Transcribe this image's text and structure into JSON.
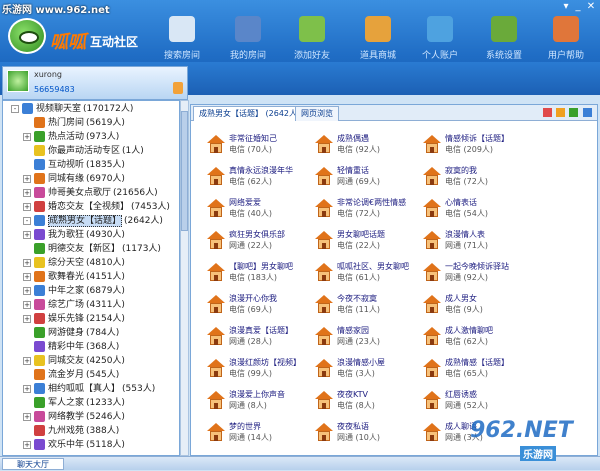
{
  "watermark_top": "乐游网 www.962.net",
  "logo": {
    "text": "呱呱",
    "subtitle": "互动社区"
  },
  "toolbar": [
    {
      "label": "搜索房间",
      "icon": "search-icon",
      "color": "#d9e7f5"
    },
    {
      "label": "我的房间",
      "icon": "computer-icon",
      "color": "#5a86c9"
    },
    {
      "label": "添加好友",
      "icon": "add-friend-icon",
      "color": "#7ec04a"
    },
    {
      "label": "道具商城",
      "icon": "shop-icon",
      "color": "#e6a23c"
    },
    {
      "label": "个人账户",
      "icon": "card-icon",
      "color": "#4ea2e0"
    },
    {
      "label": "系统设置",
      "icon": "settings-icon",
      "color": "#6aaa3a"
    },
    {
      "label": "用户帮助",
      "icon": "help-user-icon",
      "color": "#e0763a"
    }
  ],
  "user": {
    "name": "xurong",
    "id": "56659483"
  },
  "tree": [
    {
      "label": "视频聊天室",
      "count": "(170172人)",
      "level": 0,
      "expand": "-",
      "icon": "#3b7fd6"
    },
    {
      "label": "热门房间",
      "count": "(5619人)",
      "level": 1,
      "expand": "",
      "icon": "#e0731a"
    },
    {
      "label": "热点活动",
      "count": "(973人)",
      "level": 1,
      "expand": "+",
      "icon": "#3aa02a"
    },
    {
      "label": "你最声动活动专区",
      "count": "(1人)",
      "level": 1,
      "expand": "",
      "icon": "#e8c220"
    },
    {
      "label": "互动视听",
      "count": "(1835人)",
      "level": 1,
      "expand": "",
      "icon": "#3b7fd6"
    },
    {
      "label": "同城有缘",
      "count": "(6970人)",
      "level": 1,
      "expand": "+",
      "icon": "#e0731a"
    },
    {
      "label": "帅哥美女点歌厅",
      "count": "(21656人)",
      "level": 1,
      "expand": "+",
      "icon": "#c84a9a"
    },
    {
      "label": "婚恋交友【全视频】",
      "count": "(7453人)",
      "level": 1,
      "expand": "+",
      "icon": "#d04040"
    },
    {
      "label": "成熟男女【话题】",
      "count": "(2642人)",
      "level": 1,
      "expand": "-",
      "icon": "#3b7fd6",
      "selected": true
    },
    {
      "label": "我为歌狂",
      "count": "(4930人)",
      "level": 1,
      "expand": "+",
      "icon": "#7a4ad0"
    },
    {
      "label": "明德交友【新区】",
      "count": "(1173人)",
      "level": 1,
      "expand": "",
      "icon": "#3aa02a"
    },
    {
      "label": "综分天空",
      "count": "(4810人)",
      "level": 1,
      "expand": "+",
      "icon": "#e8c220"
    },
    {
      "label": "歌舞春光",
      "count": "(4151人)",
      "level": 1,
      "expand": "+",
      "icon": "#e0731a"
    },
    {
      "label": "中年之家",
      "count": "(6879人)",
      "level": 1,
      "expand": "+",
      "icon": "#3b7fd6"
    },
    {
      "label": "综艺广场",
      "count": "(4311人)",
      "level": 1,
      "expand": "+",
      "icon": "#c84a9a"
    },
    {
      "label": "娱乐先锋",
      "count": "(2154人)",
      "level": 1,
      "expand": "+",
      "icon": "#d04040"
    },
    {
      "label": "网游健身",
      "count": "(784人)",
      "level": 1,
      "expand": "",
      "icon": "#3aa02a"
    },
    {
      "label": "精彩中年",
      "count": "(368人)",
      "level": 1,
      "expand": "",
      "icon": "#7a4ad0"
    },
    {
      "label": "同城交友",
      "count": "(4250人)",
      "level": 1,
      "expand": "+",
      "icon": "#e8c220"
    },
    {
      "label": "流金岁月",
      "count": "(545人)",
      "level": 1,
      "expand": "",
      "icon": "#e0731a"
    },
    {
      "label": "相约呱呱【真人】",
      "count": "(553人)",
      "level": 1,
      "expand": "+",
      "icon": "#3b7fd6"
    },
    {
      "label": "军人之家",
      "count": "(1233人)",
      "level": 1,
      "expand": "",
      "icon": "#3aa02a"
    },
    {
      "label": "网络教学",
      "count": "(5246人)",
      "level": 1,
      "expand": "+",
      "icon": "#c84a9a"
    },
    {
      "label": "九州戏苑",
      "count": "(388人)",
      "level": 1,
      "expand": "",
      "icon": "#d04040"
    },
    {
      "label": "欢乐中年",
      "count": "(5118人)",
      "level": 1,
      "expand": "+",
      "icon": "#7a4ad0"
    }
  ],
  "tabs": [
    {
      "label": "成熟男女【话题】 (2642人)",
      "active": true
    },
    {
      "label": "网页浏览",
      "active": false
    }
  ],
  "rooms": [
    {
      "name": "非常征婚知己",
      "info": "电信 (70人)"
    },
    {
      "name": "成熟偶遇",
      "info": "电信 (92人)"
    },
    {
      "name": "情感倾诉【话题】",
      "info": "电信 (209人)"
    },
    {
      "name": "真情永远浪漫年华",
      "info": "电信 (62人)"
    },
    {
      "name": "轻情重话",
      "info": "网通 (69人)"
    },
    {
      "name": "寂寞的我",
      "info": "电信 (72人)"
    },
    {
      "name": "网络爱爱",
      "info": "电信 (40人)"
    },
    {
      "name": "非常论调€两性情感",
      "info": "电信 (72人)"
    },
    {
      "name": "心情表话",
      "info": "电信 (54人)"
    },
    {
      "name": "疯狂男女俱乐部",
      "info": "网通 (22人)"
    },
    {
      "name": "男女聊吧话题",
      "info": "电信 (22人)"
    },
    {
      "name": "浪漫情人表",
      "info": "网通 (71人)"
    },
    {
      "name": "【聊吧】男女聊吧",
      "info": "电信 (183人)"
    },
    {
      "name": "呱呱社区、男女聊吧",
      "info": "电信 (61人)"
    },
    {
      "name": "一起今晚倾诉驿站",
      "info": "网通 (92人)"
    },
    {
      "name": "浪漫开心你我",
      "info": "电信 (69人)"
    },
    {
      "name": "今夜不寂寞",
      "info": "电信 (11人)"
    },
    {
      "name": "成人男女",
      "info": "电信 (9人)"
    },
    {
      "name": "浪漫真爱【话题】",
      "info": "网通 (28人)"
    },
    {
      "name": "情感家园",
      "info": "网通 (23人)"
    },
    {
      "name": "成人激情聊吧",
      "info": "电信 (62人)"
    },
    {
      "name": "浪漫红颜坊【视频】",
      "info": "电信 (99人)"
    },
    {
      "name": "浪漫情感小屋",
      "info": "电信 (3人)"
    },
    {
      "name": "成熟情感【话题】",
      "info": "电信 (65人)"
    },
    {
      "name": "浪漫爱上你声音",
      "info": "网通 (8人)"
    },
    {
      "name": "夜夜KTV",
      "info": "电信 (8人)"
    },
    {
      "name": "红唇诱惑",
      "info": "网通 (52人)"
    },
    {
      "name": "梦的世界",
      "info": "网通 (14人)"
    },
    {
      "name": "夜夜私语",
      "info": "网通 (10人)"
    },
    {
      "name": "成人聊语",
      "info": "网通 (3人)"
    }
  ],
  "status_tab": "聊天大厅",
  "watermark": {
    "text": "962.NET",
    "sub": "乐游网"
  }
}
